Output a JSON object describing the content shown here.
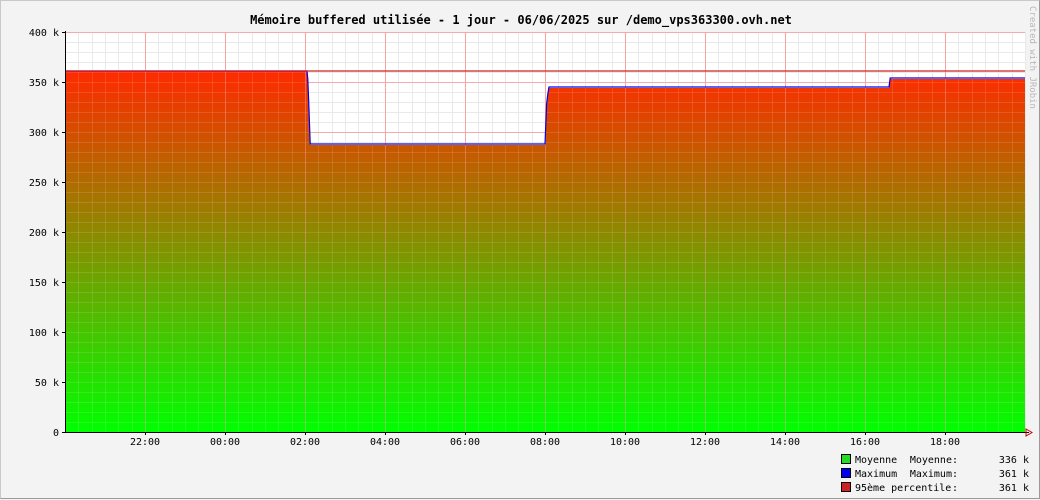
{
  "chart_data": {
    "type": "area",
    "title": "Mémoire buffered utilisée - 1 jour - 06/06/2025 sur /demo_vps363300.ovh.net",
    "watermark": "Created with JRobin",
    "ylim": [
      0,
      400000
    ],
    "y_ticks": [
      {
        "value": 0,
        "label": "0"
      },
      {
        "value": 50000,
        "label": "50 k"
      },
      {
        "value": 100000,
        "label": "100 k"
      },
      {
        "value": 150000,
        "label": "150 k"
      },
      {
        "value": 200000,
        "label": "200 k"
      },
      {
        "value": 250000,
        "label": "250 k"
      },
      {
        "value": 300000,
        "label": "300 k"
      },
      {
        "value": 350000,
        "label": "350 k"
      },
      {
        "value": 400000,
        "label": "400 k"
      }
    ],
    "xlim_hours": [
      20,
      44
    ],
    "x_ticks": [
      {
        "value": 22,
        "label": "22:00"
      },
      {
        "value": 24,
        "label": "00:00"
      },
      {
        "value": 26,
        "label": "02:00"
      },
      {
        "value": 28,
        "label": "04:00"
      },
      {
        "value": 30,
        "label": "06:00"
      },
      {
        "value": 32,
        "label": "08:00"
      },
      {
        "value": 34,
        "label": "10:00"
      },
      {
        "value": 36,
        "label": "12:00"
      },
      {
        "value": 38,
        "label": "14:00"
      },
      {
        "value": 40,
        "label": "16:00"
      },
      {
        "value": 42,
        "label": "18:00"
      }
    ],
    "grid": true,
    "legend_position": "bottom-right",
    "series": [
      {
        "name": "Moyenne",
        "color": "#22dd22",
        "x": [
          20.0,
          26.05,
          26.07,
          26.1,
          26.13,
          32.0,
          32.04,
          32.07,
          32.1,
          40.6,
          40.63,
          44.0
        ],
        "values": [
          361000,
          361000,
          352000,
          322000,
          287000,
          287000,
          327000,
          337000,
          344000,
          344000,
          353000,
          353000
        ]
      },
      {
        "name": "Maximum",
        "color": "#0000ee",
        "x": [
          20.0,
          26.05,
          26.07,
          26.1,
          26.13,
          32.0,
          32.04,
          32.07,
          32.1,
          40.6,
          40.63,
          44.0
        ],
        "values": [
          361000,
          361000,
          353000,
          323000,
          288000,
          288000,
          328000,
          338000,
          345000,
          345000,
          354000,
          354000
        ]
      },
      {
        "name": "95ème percentile",
        "color": "#cc2222",
        "x": [
          20.0,
          44.0
        ],
        "values": [
          361000,
          361000
        ]
      }
    ],
    "legend": [
      {
        "color": "#22dd22",
        "name": "Moyenne",
        "label": "Moyenne:",
        "value": "336 k"
      },
      {
        "color": "#0000ee",
        "name": "Maximum",
        "label": "Maximum:",
        "value": "361 k"
      },
      {
        "color": "#cc2222",
        "name": "95ème percentile",
        "label": ":",
        "value": "361 k"
      }
    ]
  }
}
